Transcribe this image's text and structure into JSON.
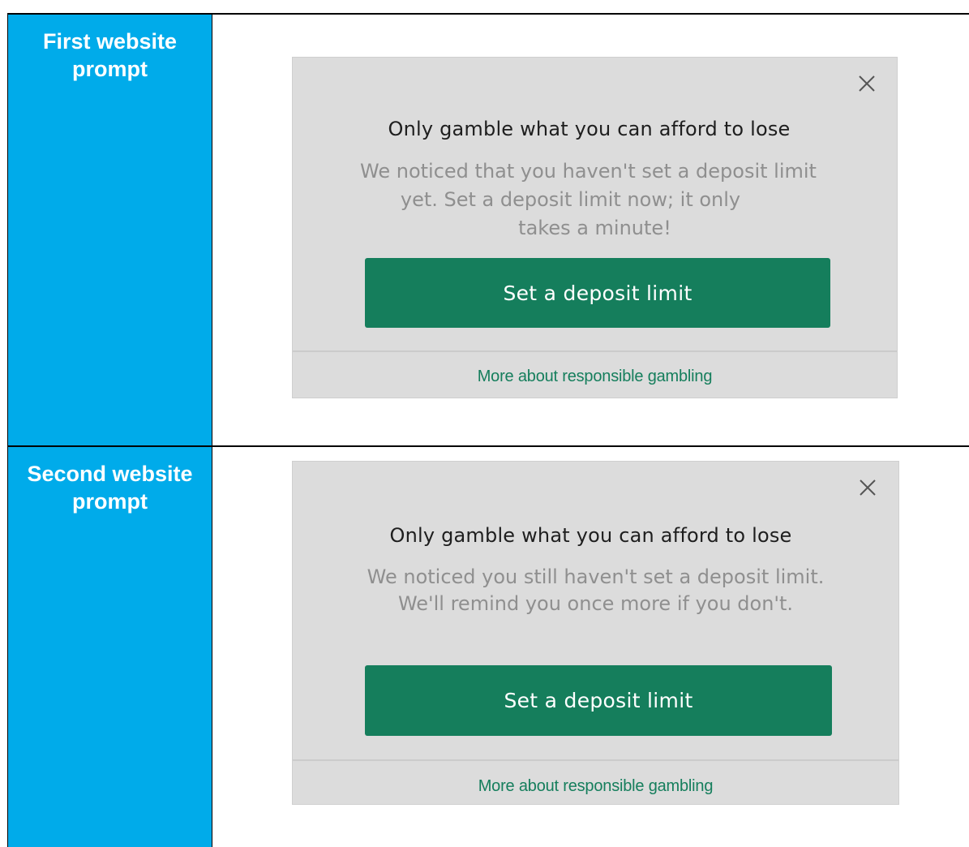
{
  "rows": [
    {
      "label_line1": "First website",
      "label_line2": "prompt",
      "prompt": {
        "title": "Only gamble what you can afford to lose",
        "body_lines": [
          "We noticed that you haven't set a deposit limit",
          "yet. Set a deposit limit now; it only",
          "takes a minute!"
        ],
        "button_label": "Set a deposit limit",
        "footer_link": "More about responsible gambling",
        "close_icon": "close-icon"
      }
    },
    {
      "label_line1": "Second website",
      "label_line2": "prompt",
      "prompt": {
        "title": "Only gamble what you can afford to lose",
        "body_lines": [
          "We noticed you still haven't set a deposit limit.",
          "We'll remind you once more if you don't."
        ],
        "button_label": "Set a deposit limit",
        "footer_link": "More about responsible gambling",
        "close_icon": "close-icon"
      }
    }
  ],
  "colors": {
    "label_background": "#00ABEA",
    "label_text": "#FFFFFF",
    "panel_background": "#DCDCDC",
    "button_green": "#157E5C",
    "body_text_gray": "#8F8F8F"
  }
}
